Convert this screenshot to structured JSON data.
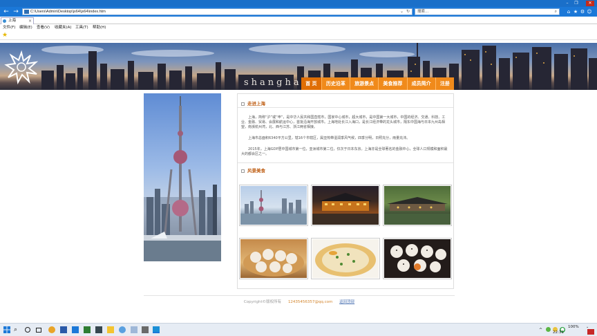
{
  "browser": {
    "address": "C:\\Users\\Admin\\Desktop\\jx64\\jx64\\index.htm",
    "search_placeholder": "搜索...",
    "tab_title": "上海",
    "menu": [
      "文件(F)",
      "编辑(E)",
      "查看(V)",
      "收藏夹(A)",
      "工具(T)",
      "帮助(H)"
    ]
  },
  "site": {
    "banner_word": "shanghai",
    "nav": [
      "首 页",
      "历史沿革",
      "旅游景点",
      "美食推荐",
      "成员简介",
      "注册"
    ],
    "section1_title": "走进上海",
    "paragraphs": [
      "上海，简称“沪”或“申”，是中华人民共和国直辖市，国家中心城市，超大城市，是中国第一大城市，中国的经济、交通、科技、工业、金融、贸易、会展和航运中心，首批沿海开放城市。上海地处长江入海口，是长江经济带的龙头城市，隔东中国海与日本九州岛相望，南濒杭州湾，北、西与江苏、浙江两省相接。",
      "上海市总面积6340平方公里，辖16个市辖区，属亚热带湿润季风气候，四季分明，日照充分，雨量充沛。",
      "2015年，上海GDP居中国城市第一位，亚洲城市第二位，仅次于日本东京。上海亦是全球著名的金融中心，全球人口规模和面积最大的都会区之一。"
    ],
    "section2_title": "风景美食",
    "footer": {
      "copyright": "Copyright©版权所有",
      "email": "12435456357@qq.com",
      "back_top": "返回顶部"
    }
  },
  "taskbar": {
    "zoom": "100%",
    "time": "22:31"
  },
  "colors": {
    "nav_orange": "#f08a1b",
    "title_bar": "#1a6fc9",
    "section_title": "#c0621a"
  }
}
